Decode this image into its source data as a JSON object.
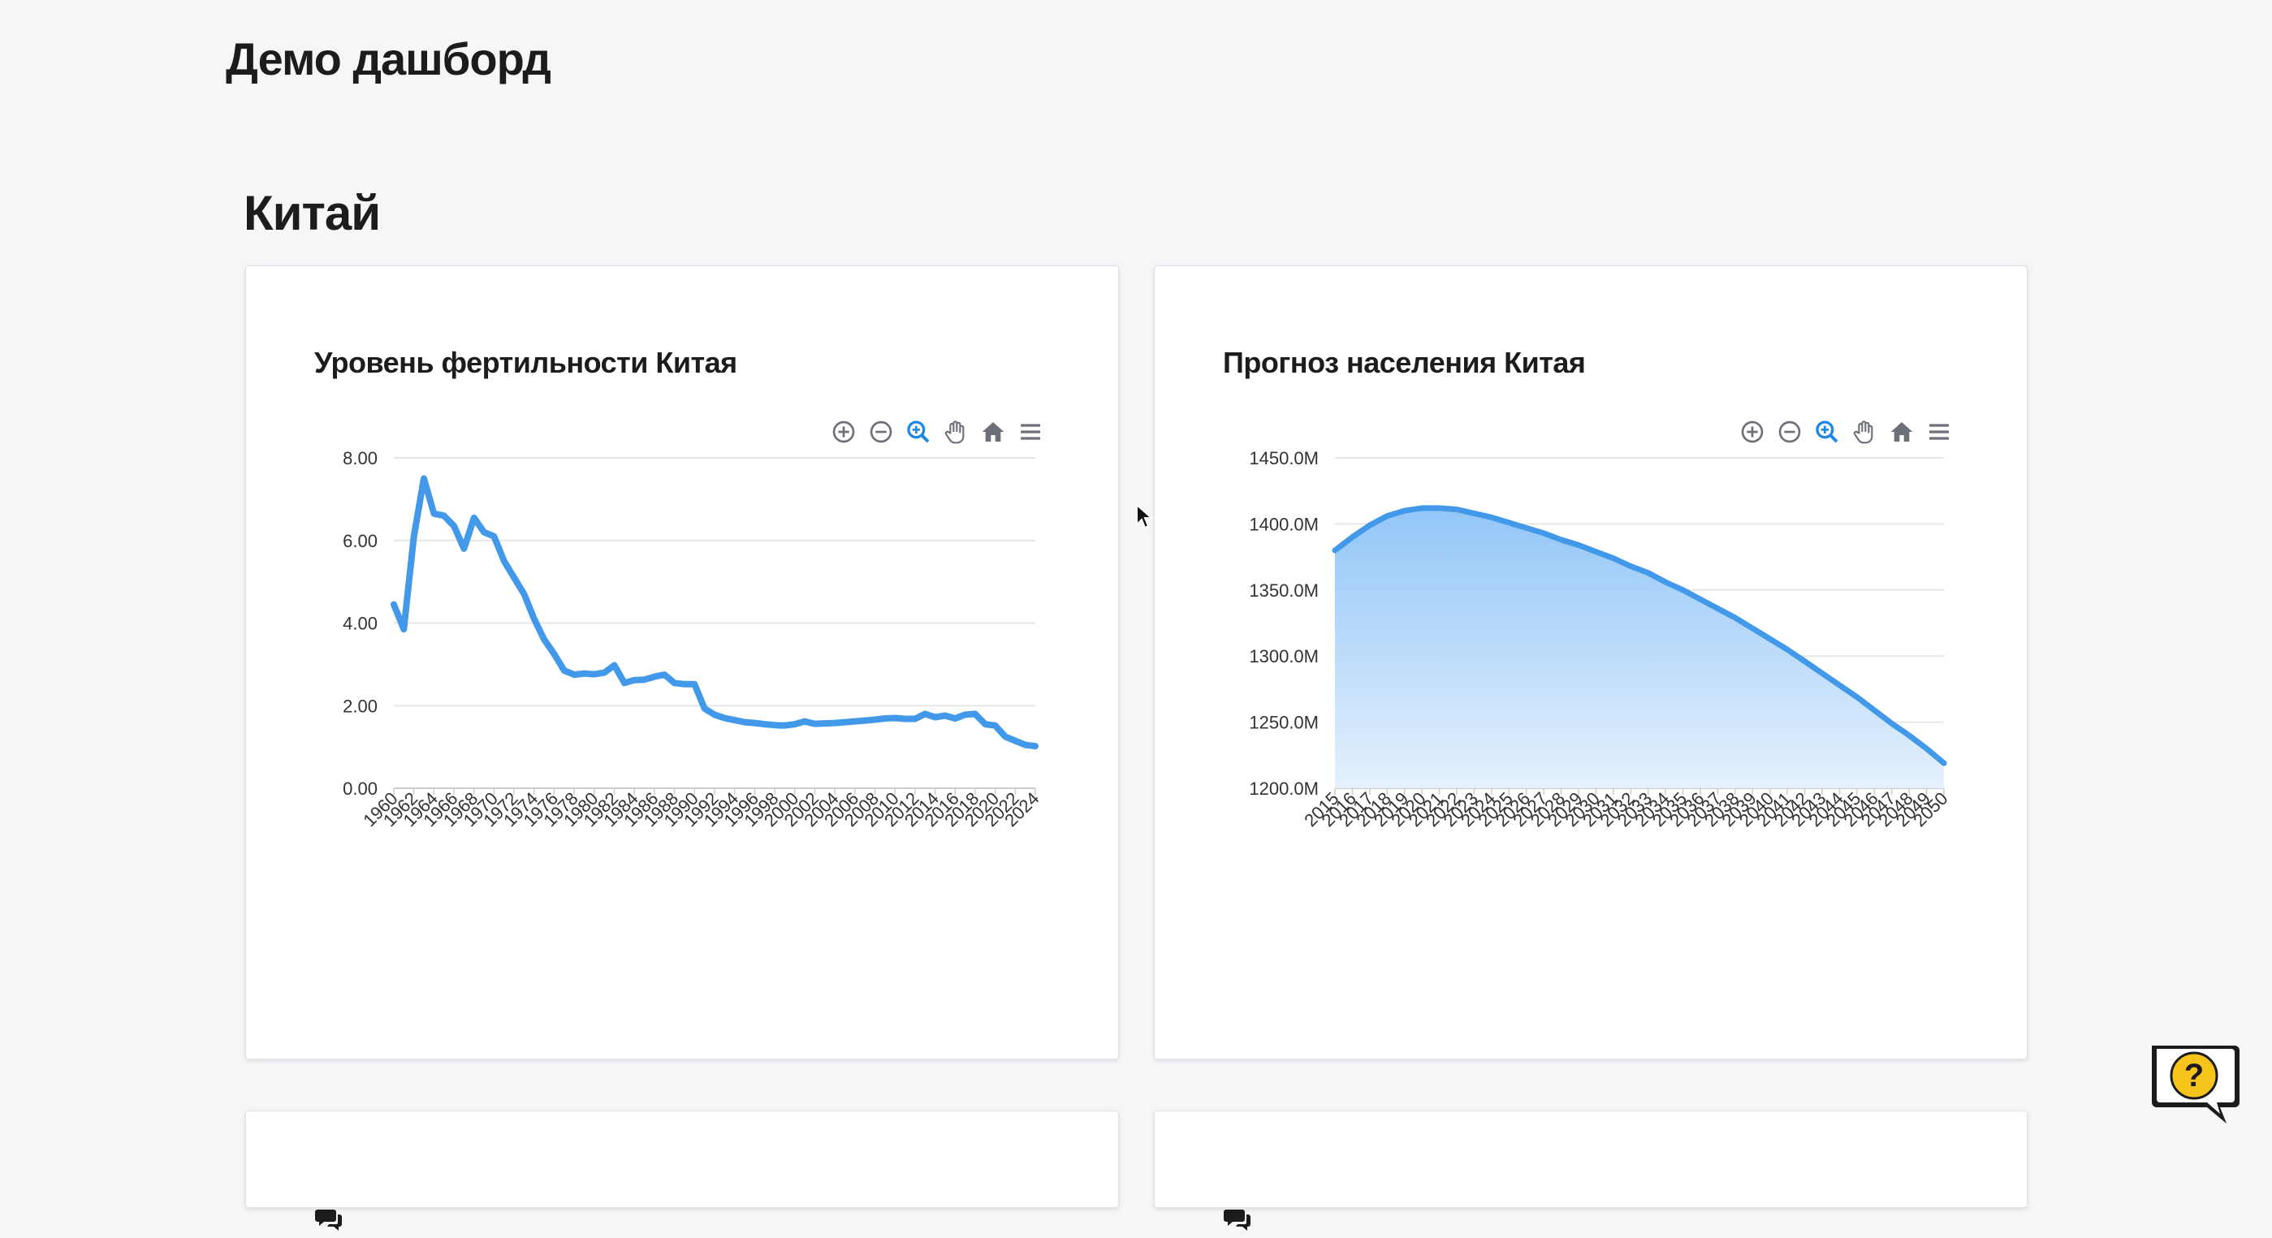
{
  "page": {
    "title": "Демо дашборд"
  },
  "section": {
    "title": "Китай"
  },
  "toolbar_icons": [
    "zoom-in-icon",
    "zoom-out-icon",
    "selection-zoom-icon",
    "pan-icon",
    "home-icon",
    "menu-icon"
  ],
  "colors": {
    "series": "#4299ea",
    "area_top": "#8dc3f7",
    "area_bottom": "#e3f0fd",
    "grid": "#e6e6e6",
    "active_tool": "#1e88e5",
    "help_bubble": "#f7c41b"
  },
  "charts": [
    {
      "title": "Уровень фертильности Китая",
      "chart_data": {
        "type": "line",
        "title": "Уровень фертильности Китая",
        "x": [
          1960,
          1961,
          1962,
          1963,
          1964,
          1965,
          1966,
          1967,
          1968,
          1969,
          1970,
          1971,
          1972,
          1973,
          1974,
          1975,
          1976,
          1977,
          1978,
          1979,
          1980,
          1981,
          1982,
          1983,
          1984,
          1985,
          1986,
          1987,
          1988,
          1989,
          1990,
          1991,
          1992,
          1993,
          1994,
          1995,
          1996,
          1997,
          1998,
          1999,
          2000,
          2001,
          2002,
          2003,
          2004,
          2005,
          2006,
          2007,
          2008,
          2009,
          2010,
          2011,
          2012,
          2013,
          2014,
          2015,
          2016,
          2017,
          2018,
          2019,
          2020,
          2021,
          2022,
          2023,
          2024
        ],
        "series": [
          {
            "values": [
              4.45,
              3.85,
              6.1,
              7.5,
              6.65,
              6.6,
              6.35,
              5.8,
              6.55,
              6.2,
              6.1,
              5.5,
              5.1,
              4.7,
              4.1,
              3.6,
              3.25,
              2.85,
              2.75,
              2.78,
              2.76,
              2.8,
              2.98,
              2.55,
              2.62,
              2.63,
              2.7,
              2.75,
              2.55,
              2.52,
              2.52,
              1.93,
              1.78,
              1.7,
              1.65,
              1.6,
              1.58,
              1.55,
              1.53,
              1.52,
              1.55,
              1.62,
              1.56,
              1.57,
              1.58,
              1.6,
              1.62,
              1.64,
              1.66,
              1.69,
              1.7,
              1.68,
              1.68,
              1.8,
              1.72,
              1.76,
              1.69,
              1.78,
              1.8,
              1.55,
              1.52,
              1.25,
              1.15,
              1.05,
              1.02
            ]
          }
        ],
        "y_ticks": [
          "0.00",
          "2.00",
          "4.00",
          "6.00",
          "8.00"
        ],
        "x_tick_labels": [
          "1960",
          "1962",
          "1964",
          "1966",
          "1968",
          "1970",
          "1972",
          "1974",
          "1976",
          "1978",
          "1980",
          "1982",
          "1984",
          "1986",
          "1988",
          "1990",
          "1992",
          "1994",
          "1996",
          "1998",
          "2000",
          "2002",
          "2004",
          "2006",
          "2008",
          "2010",
          "2012",
          "2014",
          "2016",
          "2018",
          "2020",
          "2022",
          "2024"
        ],
        "ylim": [
          0,
          8
        ],
        "grid": true
      }
    },
    {
      "title": "Прогноз населения Китая",
      "chart_data": {
        "type": "area",
        "title": "Прогноз населения Китая",
        "x": [
          2015,
          2016,
          2017,
          2018,
          2019,
          2020,
          2021,
          2022,
          2023,
          2024,
          2025,
          2026,
          2027,
          2028,
          2029,
          2030,
          2031,
          2032,
          2033,
          2034,
          2035,
          2036,
          2037,
          2038,
          2039,
          2040,
          2041,
          2042,
          2043,
          2044,
          2045,
          2046,
          2047,
          2048,
          2049,
          2050
        ],
        "series": [
          {
            "values": [
              1380,
              1390,
              1399,
              1406,
              1410,
              1412,
              1412,
              1411,
              1408,
              1405,
              1401,
              1397,
              1393,
              1388,
              1384,
              1379,
              1374,
              1368,
              1363,
              1356,
              1350,
              1343,
              1336,
              1329,
              1321,
              1313,
              1305,
              1296,
              1287,
              1278,
              1269,
              1259,
              1249,
              1240,
              1230,
              1219
            ]
          }
        ],
        "y_ticks": [
          "1200.0M",
          "1250.0M",
          "1300.0M",
          "1350.0M",
          "1400.0M",
          "1450.0M"
        ],
        "x_tick_labels": [
          "2015",
          "2016",
          "2017",
          "2018",
          "2019",
          "2020",
          "2021",
          "2022",
          "2023",
          "2024",
          "2025",
          "2026",
          "2027",
          "2028",
          "2029",
          "2030",
          "2031",
          "2032",
          "2033",
          "2034",
          "2035",
          "2036",
          "2037",
          "2038",
          "2039",
          "2040",
          "2041",
          "2042",
          "2043",
          "2044",
          "2045",
          "2046",
          "2047",
          "2048",
          "2049",
          "2050"
        ],
        "ylim": [
          1200,
          1450
        ],
        "grid": true
      }
    }
  ]
}
